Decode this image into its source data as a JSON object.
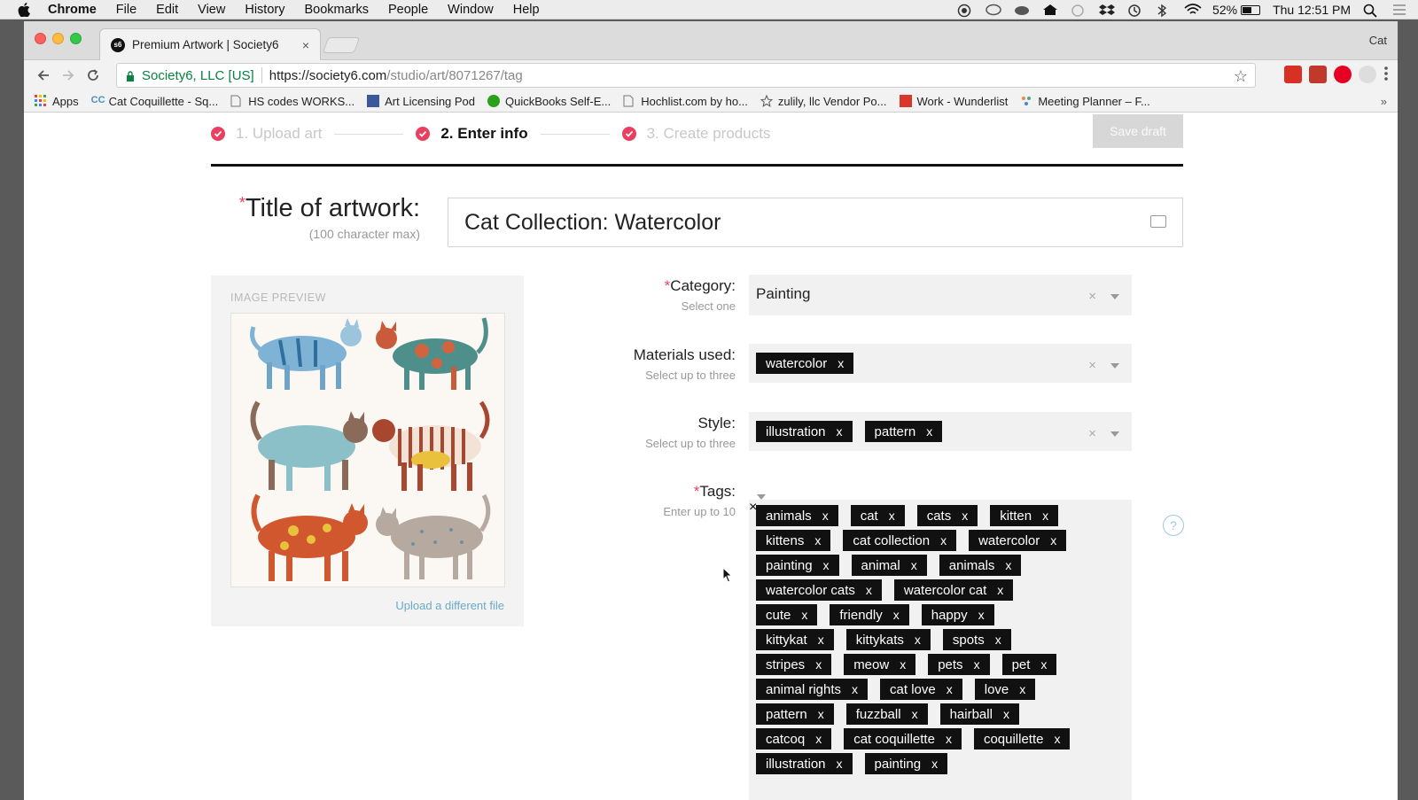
{
  "menubar": {
    "items": [
      "Chrome",
      "File",
      "Edit",
      "View",
      "History",
      "Bookmarks",
      "People",
      "Window",
      "Help"
    ],
    "battery": "52%",
    "clock": "Thu 12:51 PM"
  },
  "browser": {
    "tab_title": "Premium Artwork | Society6",
    "tab_close": "×",
    "profile": "Cat",
    "secure_label": "Society6, LLC [US]",
    "url_main": "https://society6.com",
    "url_path": "/studio/art/8071267/tag",
    "bookmarks": [
      "Apps",
      "Cat Coquillette - Sq...",
      "HS codes WORKS...",
      "Art Licensing Pod",
      "QuickBooks Self-E...",
      "Hochlist.com by ho...",
      "zulily, llc Vendor Po...",
      "Work - Wunderlist",
      "Meeting Planner – F..."
    ],
    "bookmarks_more": "»"
  },
  "steps": {
    "step1": "1. Upload art",
    "step2": "2. Enter info",
    "step3": "3. Create products",
    "save_draft": "Save draft"
  },
  "title_field": {
    "required": "*",
    "label": "Title of artwork:",
    "hint": "(100 character max)",
    "value": "Cat Collection: Watercolor"
  },
  "preview": {
    "label": "IMAGE PREVIEW",
    "upload_link": "Upload a different file"
  },
  "category": {
    "label": "Category:",
    "sub": "Select one",
    "value": "Painting"
  },
  "materials": {
    "label": "Materials used:",
    "sub": "Select up to three",
    "chips": [
      "watercolor"
    ]
  },
  "style": {
    "label": "Style:",
    "sub": "Select up to three",
    "chips": [
      "illustration",
      "pattern"
    ]
  },
  "tags": {
    "label": "Tags:",
    "sub": "Enter up to 10",
    "chips": [
      "animals",
      "cat",
      "cats",
      "kitten",
      "kittens",
      "cat collection",
      "watercolor",
      "painting",
      "animal",
      "animals",
      "watercolor cats",
      "watercolor cat",
      "cute",
      "friendly",
      "happy",
      "kittykat",
      "kittykats",
      "spots",
      "stripes",
      "meow",
      "pets",
      "pet",
      "animal rights",
      "cat love",
      "love",
      "pattern",
      "fuzzball",
      "hairball",
      "catcoq",
      "cat coquillette",
      "coquillette",
      "illustration",
      "painting"
    ]
  },
  "chip_remove": "x",
  "clear_symbol": "×",
  "help": "?"
}
